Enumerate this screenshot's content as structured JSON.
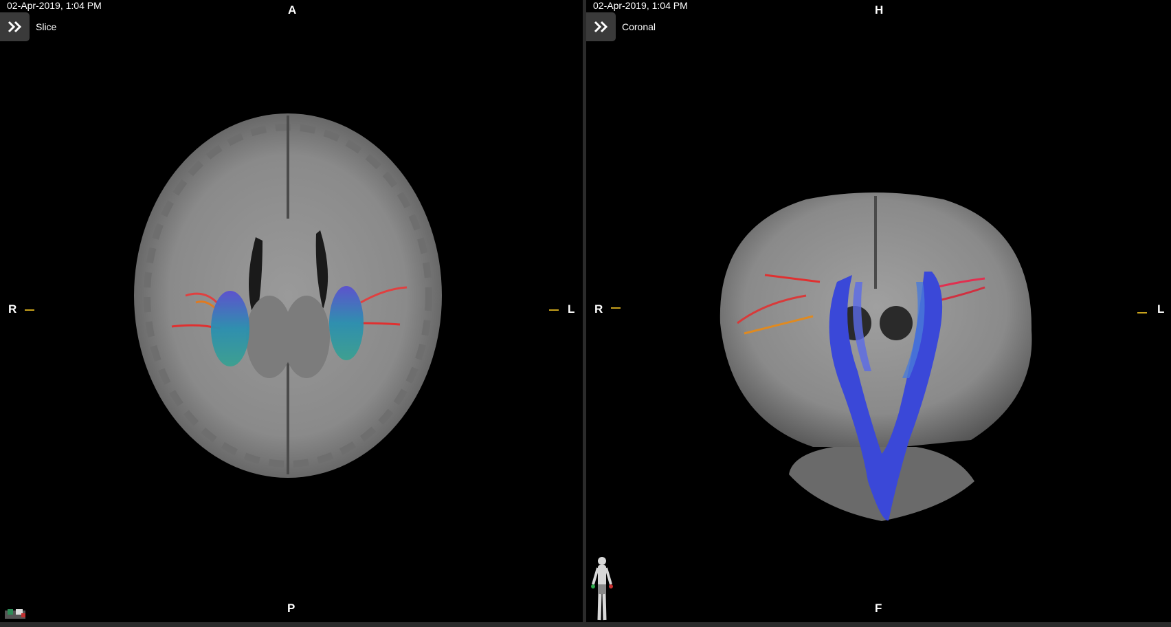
{
  "left_view": {
    "timestamp": "02-Apr-2019, 1:04 PM",
    "label": "Slice",
    "orientation": {
      "top": "A",
      "bottom": "P",
      "left": "R",
      "right": "L"
    },
    "expand_icon": "double-chevron-right-icon"
  },
  "right_view": {
    "timestamp": "02-Apr-2019, 1:04 PM",
    "label": "Coronal",
    "orientation": {
      "top": "H",
      "bottom": "F",
      "left": "R",
      "right": "L"
    },
    "expand_icon": "double-chevron-right-icon"
  },
  "colors": {
    "background": "#000000",
    "panel_border": "#2b2b2b",
    "ruler": "#c8a21c",
    "button_bg": "#3a3a3a"
  }
}
